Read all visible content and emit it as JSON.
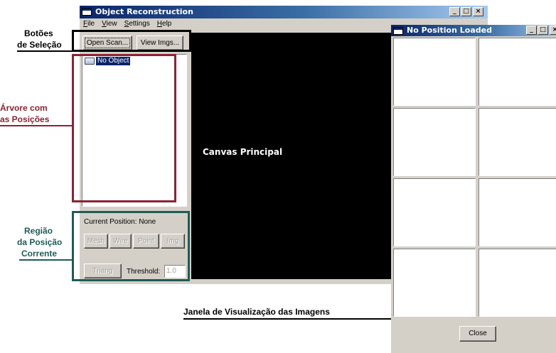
{
  "main_window": {
    "title": "Object Reconstruction",
    "controls": {
      "minimize": "_",
      "maximize": "□",
      "close": "×"
    },
    "menu": [
      "File",
      "View",
      "Settings",
      "Help"
    ],
    "buttons": {
      "open_scan": "Open Scan...",
      "view_imgs": "View Imgs..."
    },
    "tree": {
      "root_label": "No Object"
    },
    "canvas_label": "Canvas Principal",
    "current_position": {
      "title": "Current Position: None",
      "buttons": [
        "Mesh",
        "Wire",
        "Point",
        "Img"
      ],
      "triang": "Triang",
      "threshold_label": "Threshold:",
      "threshold_value": "1.0"
    }
  },
  "image_window": {
    "title": "No Position Loaded",
    "controls": {
      "minimize": "_",
      "maximize": "□",
      "close": "×"
    },
    "close_button": "Close"
  },
  "annotations": {
    "selection_buttons": [
      "Botões",
      "de Seleção"
    ],
    "tree": [
      "Árvore com",
      "as Posições"
    ],
    "current_region": [
      "Região",
      "da Posição",
      "Corrente"
    ],
    "image_window": "Janela de Visualização das Imagens"
  },
  "colors": {
    "annotation_black": "#000000",
    "annotation_red": "#8b2333",
    "annotation_teal": "#1f5b57",
    "title_active": "#0a246a"
  }
}
